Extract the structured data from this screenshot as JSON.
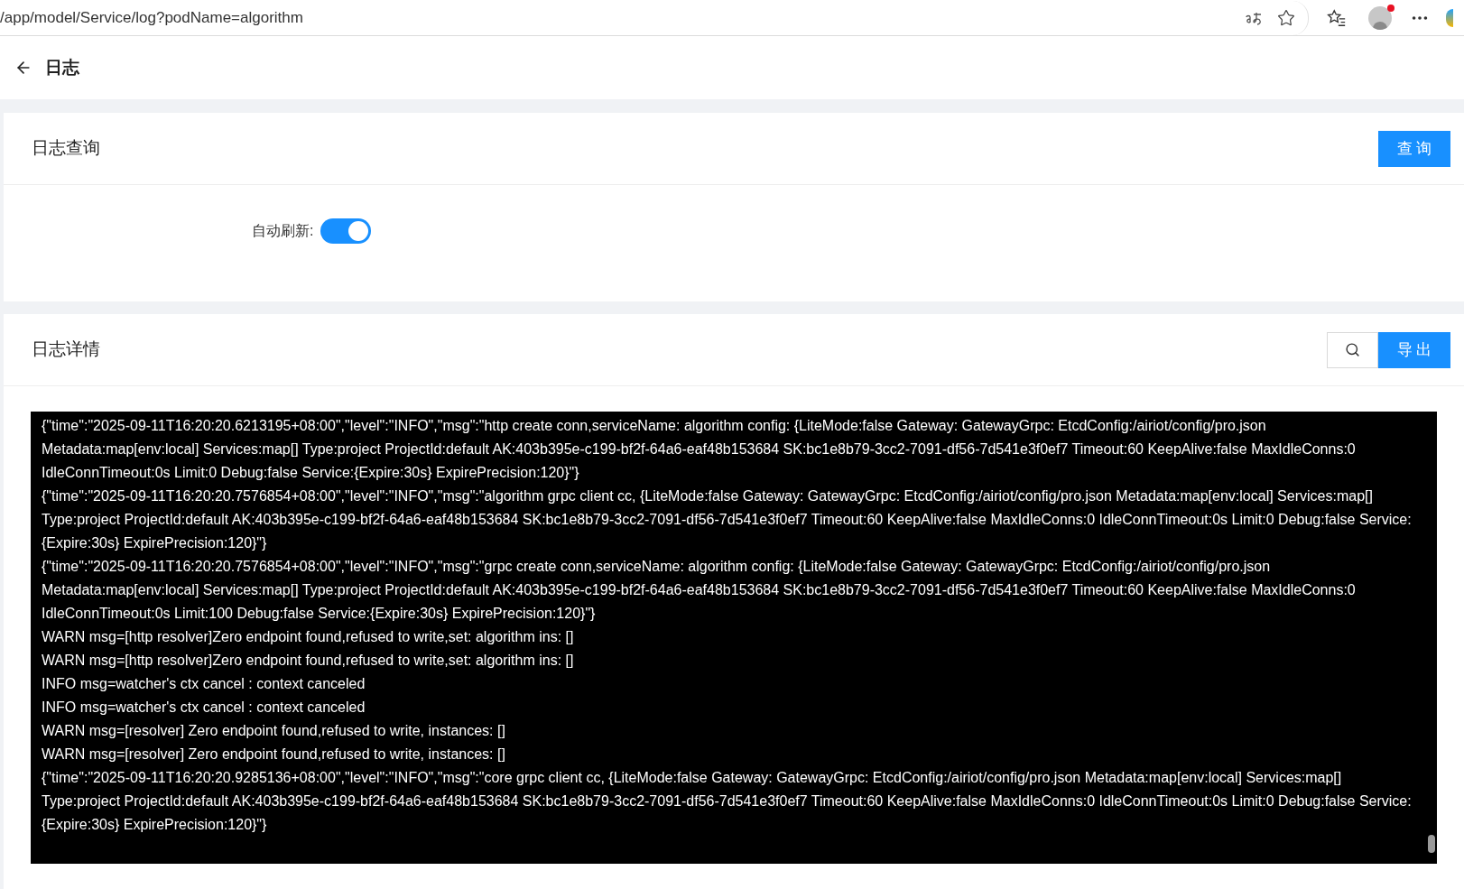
{
  "browser": {
    "url": "/app/model/Service/log?podName=algorithm",
    "profile_notification": true
  },
  "header": {
    "title": "日志"
  },
  "query_card": {
    "title": "日志查询",
    "query_button": "查 询",
    "auto_refresh": {
      "label": "自动刷新:",
      "on": true
    }
  },
  "log_card": {
    "title": "日志详情",
    "export_button": "导 出",
    "lines": [
      "{\"time\":\"2025-09-11T16:20:20.6213195+08:00\",\"level\":\"INFO\",\"msg\":\"http create conn,serviceName: algorithm config: {LiteMode:false Gateway: GatewayGrpc: EtcdConfig:/airiot/config/pro.json Metadata:map[env:local] Services:map[] Type:project ProjectId:default AK:403b395e-c199-bf2f-64a6-eaf48b153684 SK:bc1e8b79-3cc2-7091-df56-7d541e3f0ef7 Timeout:60 KeepAlive:false MaxIdleConns:0 IdleConnTimeout:0s Limit:0 Debug:false Service:{Expire:30s} ExpirePrecision:120}\"}",
      "{\"time\":\"2025-09-11T16:20:20.7576854+08:00\",\"level\":\"INFO\",\"msg\":\"algorithm grpc client cc, {LiteMode:false Gateway: GatewayGrpc: EtcdConfig:/airiot/config/pro.json Metadata:map[env:local] Services:map[] Type:project ProjectId:default AK:403b395e-c199-bf2f-64a6-eaf48b153684 SK:bc1e8b79-3cc2-7091-df56-7d541e3f0ef7 Timeout:60 KeepAlive:false MaxIdleConns:0 IdleConnTimeout:0s Limit:0 Debug:false Service:{Expire:30s} ExpirePrecision:120}\"}",
      "{\"time\":\"2025-09-11T16:20:20.7576854+08:00\",\"level\":\"INFO\",\"msg\":\"grpc create conn,serviceName: algorithm config: {LiteMode:false Gateway: GatewayGrpc: EtcdConfig:/airiot/config/pro.json Metadata:map[env:local] Services:map[] Type:project ProjectId:default AK:403b395e-c199-bf2f-64a6-eaf48b153684 SK:bc1e8b79-3cc2-7091-df56-7d541e3f0ef7 Timeout:60 KeepAlive:false MaxIdleConns:0 IdleConnTimeout:0s Limit:100 Debug:false Service:{Expire:30s} ExpirePrecision:120}\"}",
      "WARN msg=[http resolver]Zero endpoint found,refused to write,set: algorithm ins: []",
      "WARN msg=[http resolver]Zero endpoint found,refused to write,set: algorithm ins: []",
      "INFO msg=watcher's ctx cancel : context canceled",
      "INFO msg=watcher's ctx cancel : context canceled",
      "WARN msg=[resolver] Zero endpoint found,refused to write, instances: []",
      "WARN msg=[resolver] Zero endpoint found,refused to write, instances: []",
      "{\"time\":\"2025-09-11T16:20:20.9285136+08:00\",\"level\":\"INFO\",\"msg\":\"core grpc client cc, {LiteMode:false Gateway: GatewayGrpc: EtcdConfig:/airiot/config/pro.json Metadata:map[env:local] Services:map[] Type:project ProjectId:default AK:403b395e-c199-bf2f-64a6-eaf48b153684 SK:bc1e8b79-3cc2-7091-df56-7d541e3f0ef7 Timeout:60 KeepAlive:false MaxIdleConns:0 IdleConnTimeout:0s Limit:0 Debug:false Service:{Expire:30s} ExpirePrecision:120}\"}"
    ]
  }
}
